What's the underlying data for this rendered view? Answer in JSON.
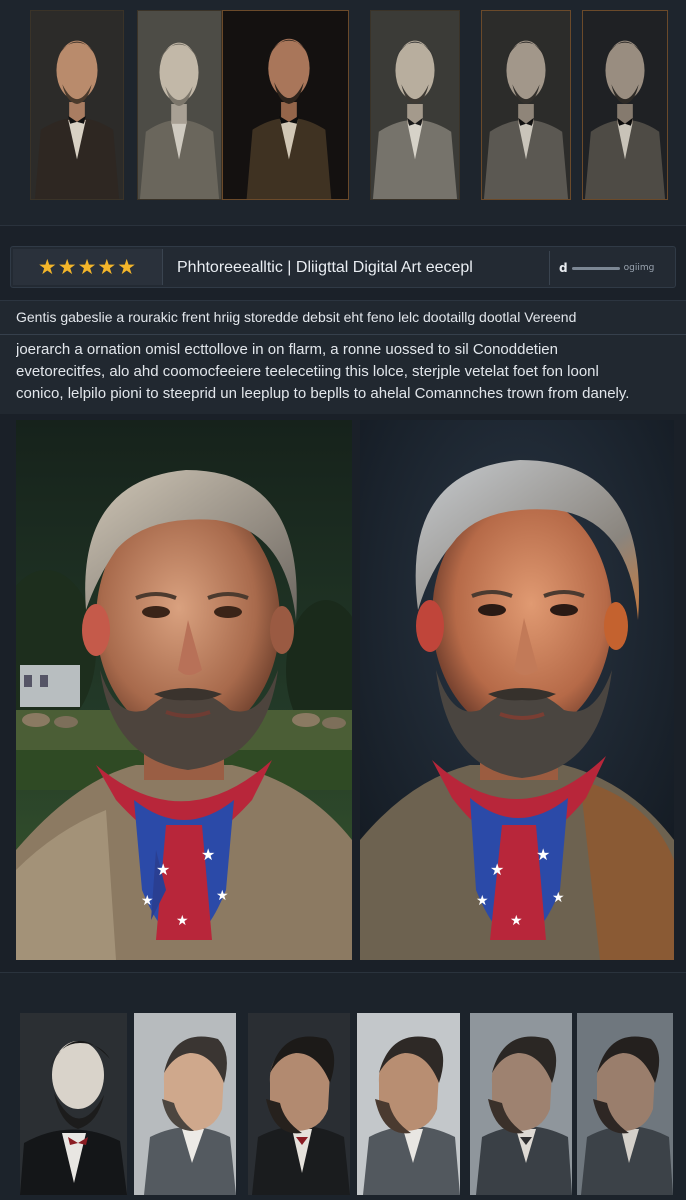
{
  "top_thumbnails": [
    {
      "name": "portrait-thumb-1"
    },
    {
      "name": "portrait-thumb-2"
    },
    {
      "name": "portrait-thumb-3"
    },
    {
      "name": "portrait-thumb-4"
    },
    {
      "name": "portrait-thumb-5"
    },
    {
      "name": "portrait-thumb-6"
    }
  ],
  "info_bar": {
    "rating": 5,
    "stars": "★★★★★",
    "style_label": "Phhtoreeealltic | Dliigttal Digital Art eecepl",
    "meta_prefix": "d",
    "meta_label": "ogiimg"
  },
  "description": {
    "line1": "Gentis gabeslie a rourakic frent hriig storedde debsit eht feno lelc dootaillg dootlal Vereend",
    "line2": "joerarch a ornation omisl ecttollove in on flarm, a ronne uossed to sil Conoddetien",
    "line3": "evetorecitfes, alo ahd coomocfeeiere teelecetiing this lolce, sterjple vetelat foet fon loonl",
    "line4": "conico, lelpilo pioni to steeprid un leeplup to beplls to ahelal Comannches trown from danely."
  },
  "main_portraits": [
    {
      "name": "main-portrait-outdoor"
    },
    {
      "name": "main-portrait-studio"
    }
  ],
  "bottom_thumbnails": [
    {
      "name": "profile-thumb-1"
    },
    {
      "name": "profile-thumb-2"
    },
    {
      "name": "profile-thumb-3"
    },
    {
      "name": "profile-thumb-4"
    },
    {
      "name": "profile-thumb-5"
    },
    {
      "name": "profile-thumb-6"
    }
  ],
  "colors": {
    "star": "#f3b52a",
    "background": "#1b2129",
    "panel": "#232a33",
    "bandana_red": "#b8263a",
    "bandana_blue": "#2b4aa8"
  }
}
